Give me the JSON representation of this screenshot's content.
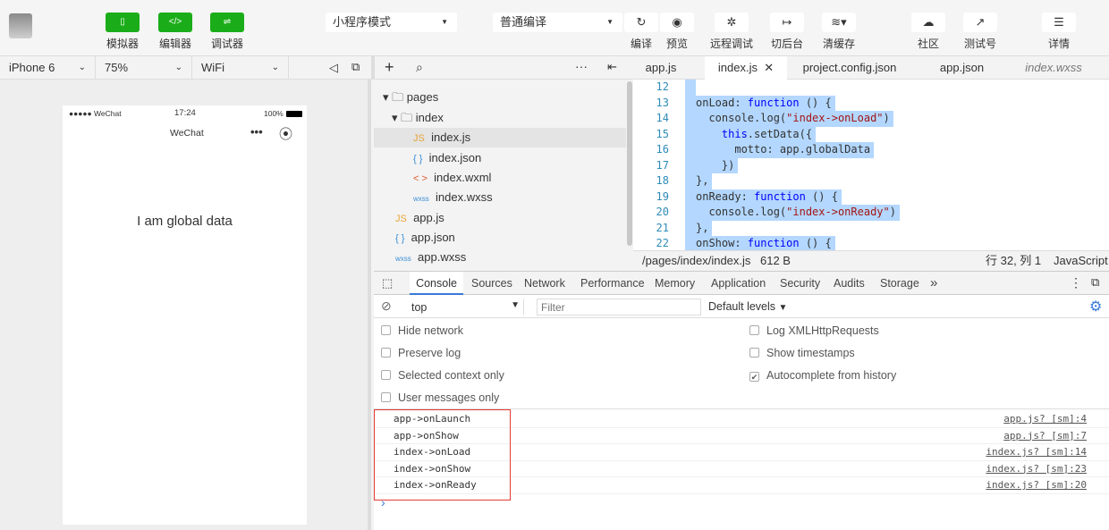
{
  "toolbar": {
    "simulator": "模拟器",
    "editor": "编辑器",
    "debugger": "调试器",
    "mode": "小程序模式",
    "compile_mode": "普通编译",
    "compile": "编译",
    "preview": "预览",
    "remote_debug": "远程调试",
    "background": "切后台",
    "clear_cache": "清缓存",
    "community": "社区",
    "test_account": "测试号",
    "details": "详情"
  },
  "simbar": {
    "device": "iPhone 6",
    "zoom": "75%",
    "network": "WiFi"
  },
  "phone": {
    "carrier": "●●●●● WeChat",
    "time": "17:24",
    "battery": "100%",
    "title": "WeChat",
    "content": "I am global data"
  },
  "tree": [
    {
      "name": "pages"
    },
    {
      "name": "index"
    },
    {
      "name": "index.js",
      "icon": "JS"
    },
    {
      "name": "index.json",
      "icon": "{ }"
    },
    {
      "name": "index.wxml",
      "icon": "< >"
    },
    {
      "name": "index.wxss",
      "icon": "wxss"
    },
    {
      "name": "app.js",
      "icon": "JS"
    },
    {
      "name": "app.json",
      "icon": "{ }"
    },
    {
      "name": "app.wxss",
      "icon": "wxss"
    }
  ],
  "tabs": [
    "app.js",
    "index.js",
    "project.config.json",
    "app.json",
    "index.wxss"
  ],
  "code": [
    {
      "n": "12",
      "parts": []
    },
    {
      "n": "13",
      "parts": [
        [
          "",
          "onLoad: "
        ],
        [
          "kw",
          "function"
        ],
        [
          "",
          " () {"
        ]
      ]
    },
    {
      "n": "14",
      "parts": [
        [
          "",
          "  console.log("
        ],
        [
          "str",
          "\"index->onLoad\""
        ],
        [
          "",
          ")"
        ]
      ]
    },
    {
      "n": "15",
      "parts": [
        [
          "kw",
          "    this"
        ],
        [
          "",
          ".setData({"
        ]
      ]
    },
    {
      "n": "16",
      "parts": [
        [
          "",
          "      motto: app.globalData"
        ]
      ]
    },
    {
      "n": "17",
      "parts": [
        [
          "",
          "    })"
        ]
      ]
    },
    {
      "n": "18",
      "parts": [
        [
          "",
          "},"
        ]
      ]
    },
    {
      "n": "19",
      "parts": [
        [
          "",
          "onReady: "
        ],
        [
          "kw",
          "function"
        ],
        [
          "",
          " () {"
        ]
      ]
    },
    {
      "n": "20",
      "parts": [
        [
          "",
          "  console.log("
        ],
        [
          "str",
          "\"index->onReady\""
        ],
        [
          "",
          ")"
        ]
      ]
    },
    {
      "n": "21",
      "parts": [
        [
          "",
          "},"
        ]
      ]
    },
    {
      "n": "22",
      "parts": [
        [
          "",
          "onShow: "
        ],
        [
          "kw",
          "function"
        ],
        [
          "",
          " () {"
        ]
      ]
    }
  ],
  "status": {
    "path": "/pages/index/index.js",
    "size": "612 B",
    "position": "行 32, 列 1",
    "language": "JavaScript"
  },
  "devtools": {
    "tabs": [
      "Console",
      "Sources",
      "Network",
      "Performance",
      "Memory",
      "Application",
      "Security",
      "Audits",
      "Storage"
    ],
    "more": "»",
    "context": "top",
    "filter_placeholder": "Filter",
    "levels": "Default levels",
    "options_left": [
      {
        "label": "Hide network",
        "checked": false
      },
      {
        "label": "Preserve log",
        "checked": false
      },
      {
        "label": "Selected context only",
        "checked": false
      },
      {
        "label": "User messages only",
        "checked": false
      }
    ],
    "options_right": [
      {
        "label": "Log XMLHttpRequests",
        "checked": false
      },
      {
        "label": "Show timestamps",
        "checked": false
      },
      {
        "label": "Autocomplete from history",
        "checked": true
      }
    ],
    "logs": [
      {
        "msg": "app->onLaunch",
        "src": "app.js? [sm]:4"
      },
      {
        "msg": "app->onShow",
        "src": "app.js? [sm]:7"
      },
      {
        "msg": "index->onLoad",
        "src": "index.js? [sm]:14"
      },
      {
        "msg": "index->onShow",
        "src": "index.js? [sm]:23"
      },
      {
        "msg": "index->onReady",
        "src": "index.js? [sm]:20"
      }
    ],
    "prompt": "›"
  }
}
